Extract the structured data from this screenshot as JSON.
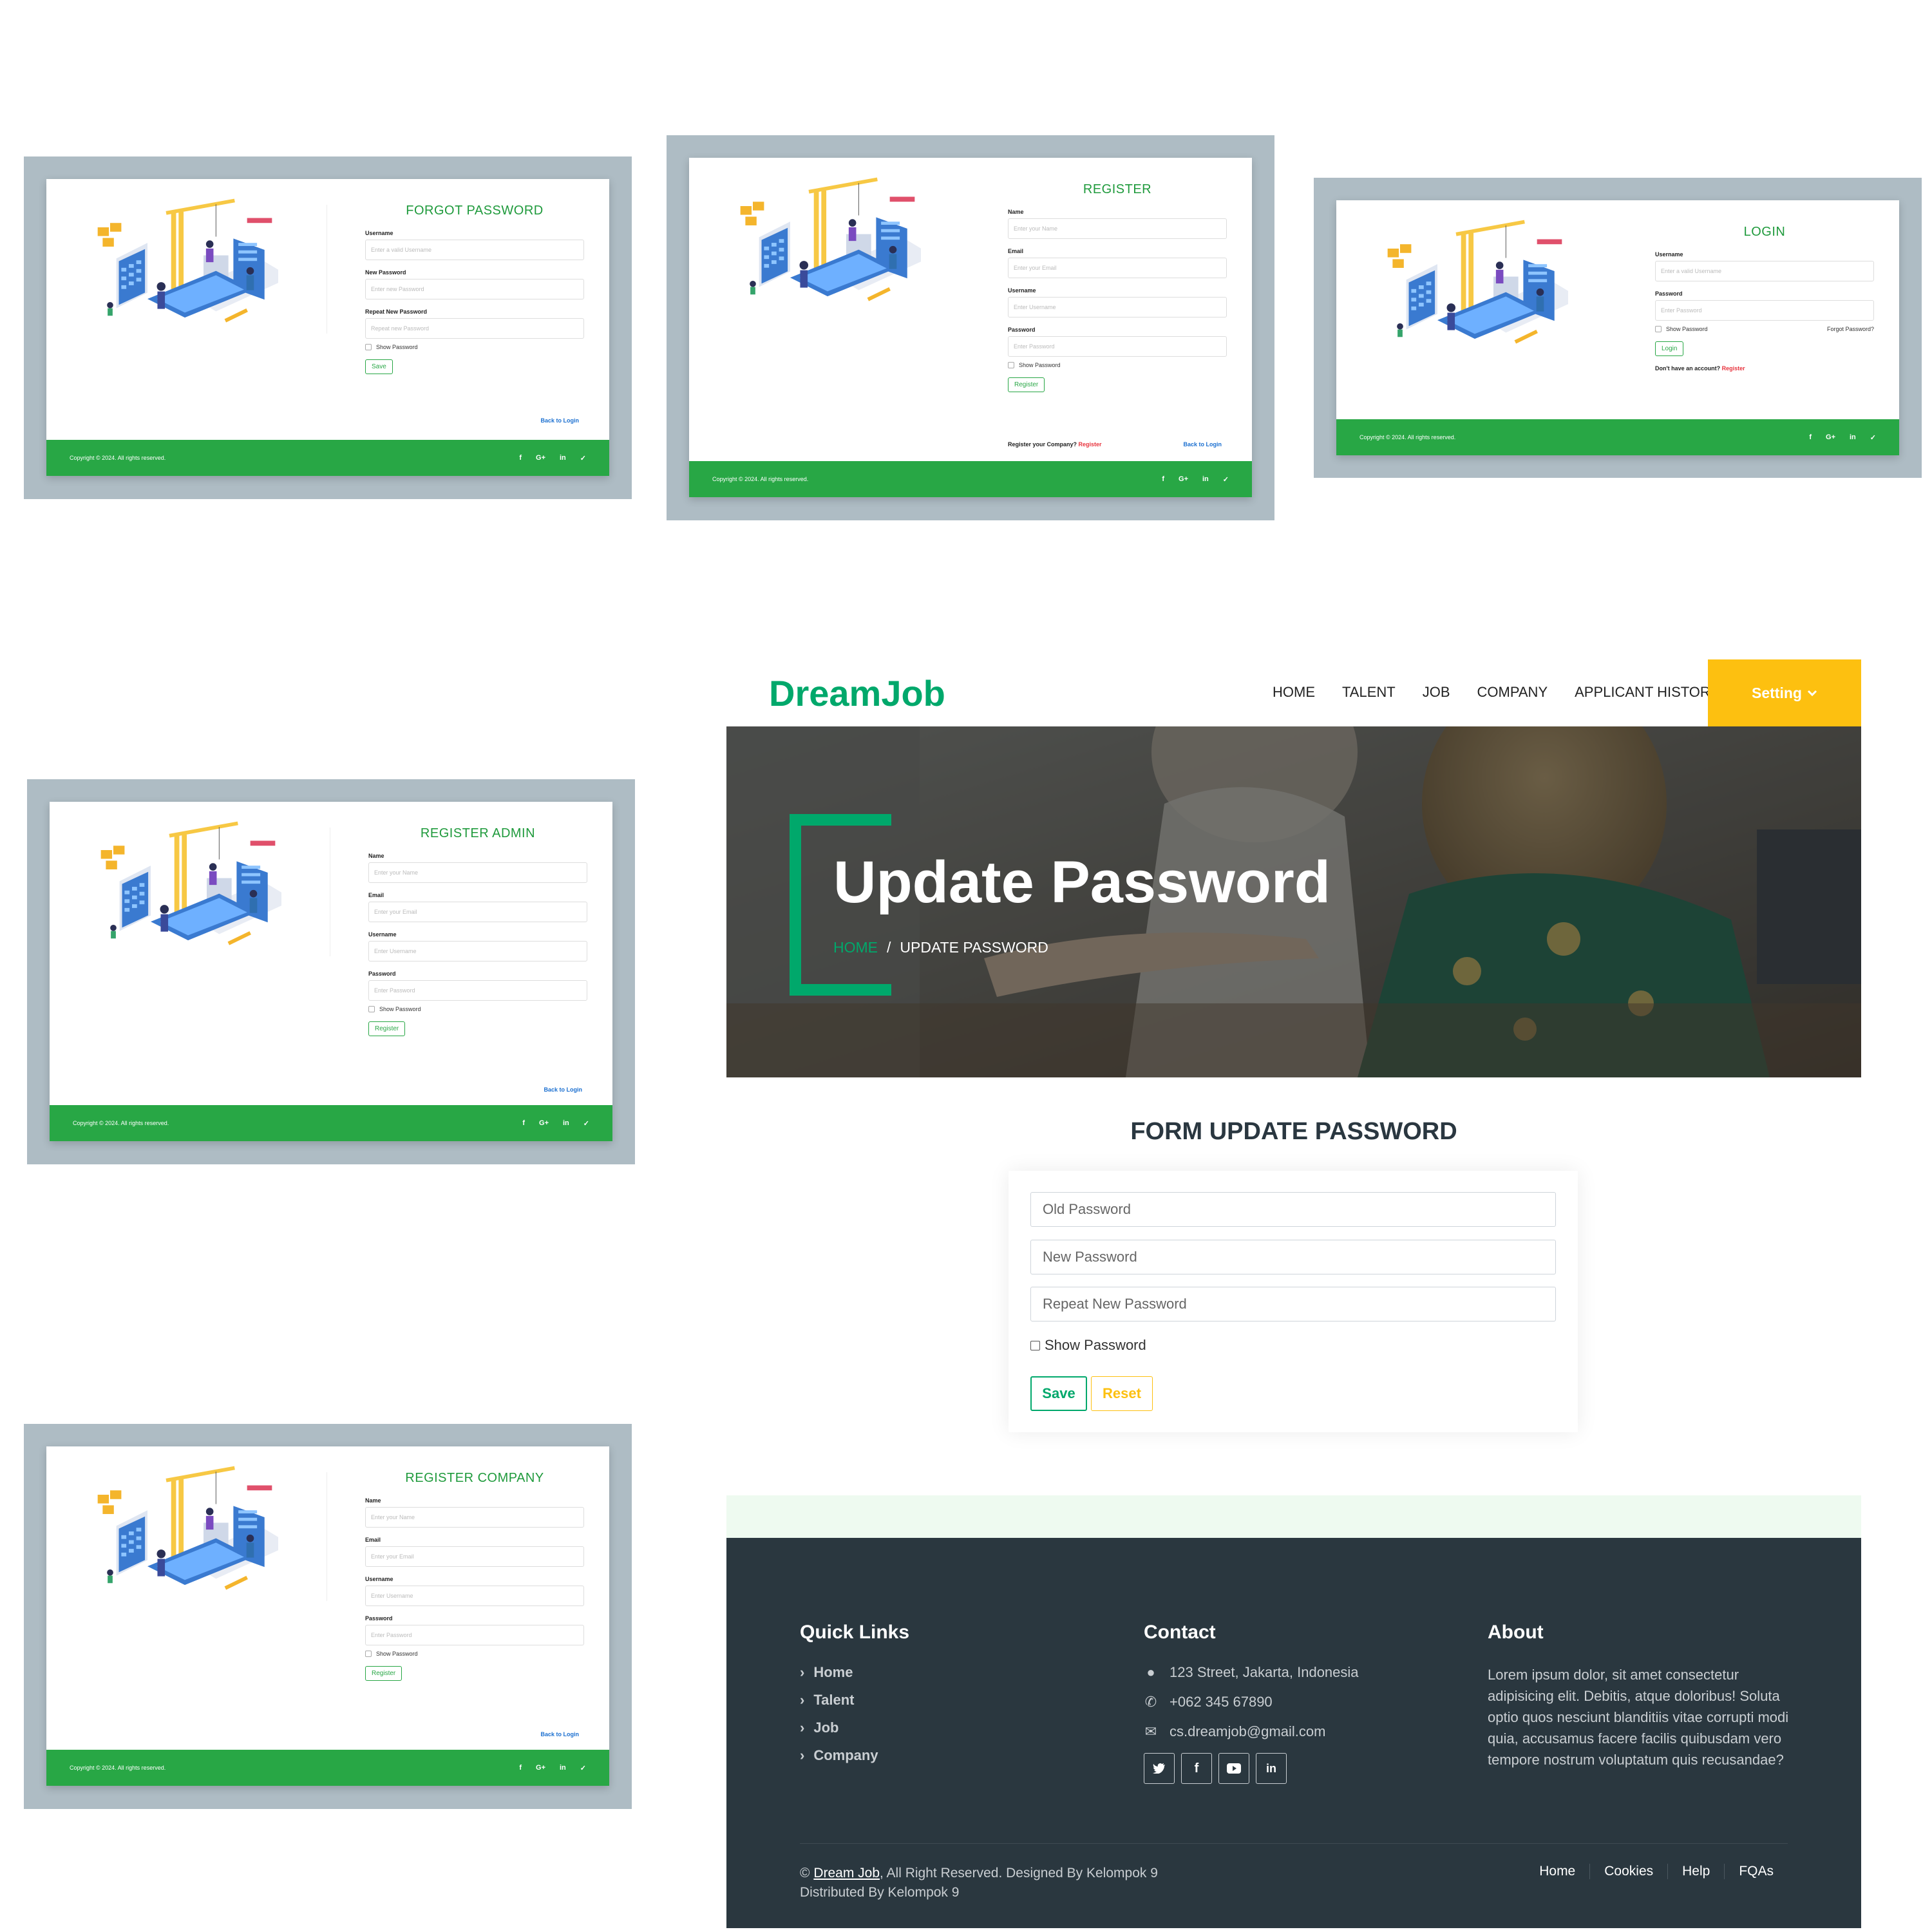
{
  "screens": {
    "forgot": {
      "title": "FORGOT PASSWORD",
      "fields": [
        {
          "label": "Username",
          "placeholder": "Enter a valid Username"
        },
        {
          "label": "New Password",
          "placeholder": "Enter new Password"
        },
        {
          "label": "Repeat New Password",
          "placeholder": "Repeat new Password"
        }
      ],
      "show_password": "Show Password",
      "button": "Save",
      "back": "Back to Login"
    },
    "register": {
      "title": "REGISTER",
      "fields": [
        {
          "label": "Name",
          "placeholder": "Enter your Name"
        },
        {
          "label": "Email",
          "placeholder": "Enter your Email"
        },
        {
          "label": "Username",
          "placeholder": "Enter Username"
        },
        {
          "label": "Password",
          "placeholder": "Enter Password"
        }
      ],
      "show_password": "Show Password",
      "button": "Register",
      "company_prompt": "Register your Company?",
      "company_link": "Register",
      "back": "Back to Login"
    },
    "login": {
      "title": "LOGIN",
      "fields": [
        {
          "label": "Username",
          "placeholder": "Enter a valid Username"
        },
        {
          "label": "Password",
          "placeholder": "Enter Password"
        }
      ],
      "show_password": "Show Password",
      "forgot": "Forgot Password?",
      "button": "Login",
      "no_account": "Don't have an account?",
      "register_link": "Register"
    },
    "register_admin": {
      "title": "REGISTER ADMIN",
      "fields": [
        {
          "label": "Name",
          "placeholder": "Enter your Name"
        },
        {
          "label": "Email",
          "placeholder": "Enter your Email"
        },
        {
          "label": "Username",
          "placeholder": "Enter Username"
        },
        {
          "label": "Password",
          "placeholder": "Enter Password"
        }
      ],
      "show_password": "Show Password",
      "button": "Register",
      "back": "Back to Login"
    },
    "register_company": {
      "title": "REGISTER COMPANY",
      "fields": [
        {
          "label": "Name",
          "placeholder": "Enter your Name"
        },
        {
          "label": "Email",
          "placeholder": "Enter your Email"
        },
        {
          "label": "Username",
          "placeholder": "Enter Username"
        },
        {
          "label": "Password",
          "placeholder": "Enter Password"
        }
      ],
      "show_password": "Show Password",
      "button": "Register",
      "back": "Back to Login"
    },
    "copyright": "Copyright © 2024. All rights reserved.",
    "social": [
      "f",
      "G+",
      "in",
      "✓"
    ]
  },
  "main": {
    "brand": "DreamJob",
    "nav": [
      "HOME",
      "TALENT",
      "JOB",
      "COMPANY",
      "APPLICANT HISTORY"
    ],
    "setting": "Setting",
    "hero": {
      "title": "Update Password",
      "crumb_home": "HOME",
      "crumb_sep": "/",
      "crumb_current": "UPDATE PASSWORD"
    },
    "form": {
      "title": "FORM UPDATE PASSWORD",
      "placeholders": [
        "Old Password",
        "New Password",
        "Repeat New Password"
      ],
      "show_password": "Show Password",
      "save": "Save",
      "reset": "Reset"
    },
    "footer": {
      "quick_title": "Quick Links",
      "quick_links": [
        "Home",
        "Talent",
        "Job",
        "Company"
      ],
      "contact_title": "Contact",
      "address": "123 Street, Jakarta, Indonesia",
      "phone": "+062 345 67890",
      "email": "cs.dreamjob@gmail.com",
      "about_title": "About",
      "about_text": "Lorem ipsum dolor, sit amet consectetur adipisicing elit. Debitis, atque doloribus! Soluta optio quos nesciunt blanditiis vitae corrupti modi quia, accusamus facere facilis quibusdam vero tempore nostrum voluptatum quis recusandae?",
      "copy_prefix": "©",
      "copy_brand": "Dream Job",
      "copy_rest": ", All Right Reserved. Designed By Kelompok 9",
      "distributed": "Distributed By Kelompok 9",
      "links": [
        "Home",
        "Cookies",
        "Help",
        "FQAs"
      ]
    }
  },
  "colors": {
    "brand_green": "#00a86b",
    "card_green": "#28a745",
    "setting_yellow": "#fdc010",
    "footer_bg": "#2a373f",
    "frame": "#aebcc4"
  }
}
